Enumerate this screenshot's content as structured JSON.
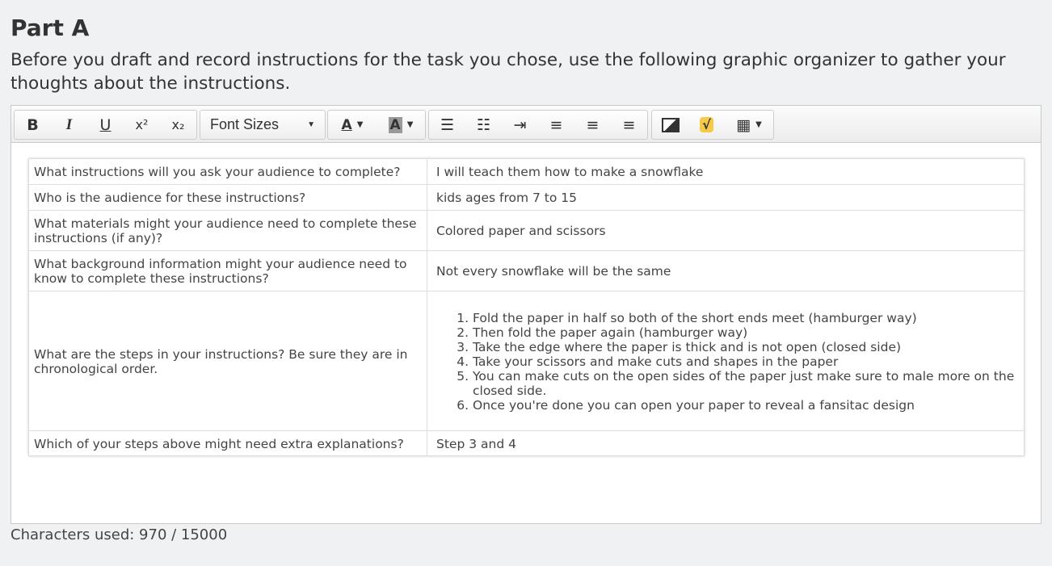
{
  "header": {
    "title": "Part A",
    "instructions": "Before you draft and record instructions for the task you chose, use the following graphic organizer to gather your thoughts about the instructions."
  },
  "toolbar": {
    "bold": "B",
    "italic": "I",
    "underline": "U",
    "superscript": "x²",
    "subscript": "x₂",
    "font_sizes": "Font Sizes",
    "text_color": "A",
    "bg_color": "A"
  },
  "table": {
    "rows": [
      {
        "q": "What instructions will you ask your audience to complete?",
        "a": "I will teach them how to make a snowflake"
      },
      {
        "q": "Who is the audience for these instructions?",
        "a": "kids ages from 7 to 15"
      },
      {
        "q": "What materials might your audience need to complete these instructions (if any)?",
        "a": "Colored paper and scissors"
      },
      {
        "q": "What background information might your audience need to know to complete these instructions?",
        "a": "Not every snowflake will be the same"
      },
      {
        "q": "What are the steps in your instructions? Be sure they are in chronological order.",
        "steps": [
          " Fold the paper in half so both of the short ends meet (hamburger way)",
          "Then fold the paper again (hamburger way)",
          "Take the edge where the paper is thick and is not open (closed side)",
          "Take your scissors and make cuts and shapes in the paper",
          "You can make cuts on the open sides of the paper just make sure to male more on the closed side.",
          "Once you're done you can open your paper to reveal a fansitac design"
        ]
      },
      {
        "q": "Which of your steps above might need extra explanations?",
        "a": "Step 3 and 4"
      }
    ]
  },
  "footer": {
    "chars": "Characters used: 970 / 15000"
  }
}
